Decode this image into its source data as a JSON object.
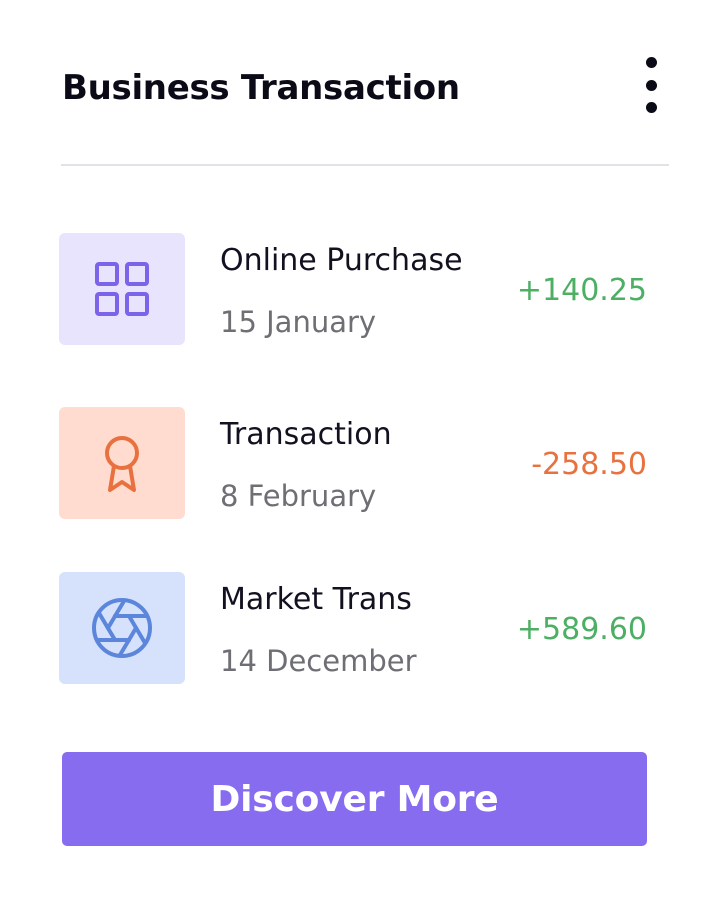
{
  "header": {
    "title": "Business Transaction",
    "menu_icon": "more-vertical-icon"
  },
  "transactions": [
    {
      "name": "Online Purchase",
      "date": "15 January",
      "amount": "+140.25",
      "icon": "grid-icon",
      "icon_bg": "#e9e4fd",
      "icon_color": "#7d63ea",
      "amount_color": "#4caf63"
    },
    {
      "name": "Transaction",
      "date": "8 February",
      "amount": "-258.50",
      "icon": "award-icon",
      "icon_bg": "#ffdccf",
      "icon_color": "#e8713f",
      "amount_color": "#e8713f"
    },
    {
      "name": "Market Trans",
      "date": "14 December",
      "amount": "+589.60",
      "icon": "aperture-icon",
      "icon_bg": "#d6e2fb",
      "icon_color": "#5b86dc",
      "amount_color": "#4caf63"
    }
  ],
  "cta": {
    "label": "Discover More",
    "color": "#876cf0"
  }
}
